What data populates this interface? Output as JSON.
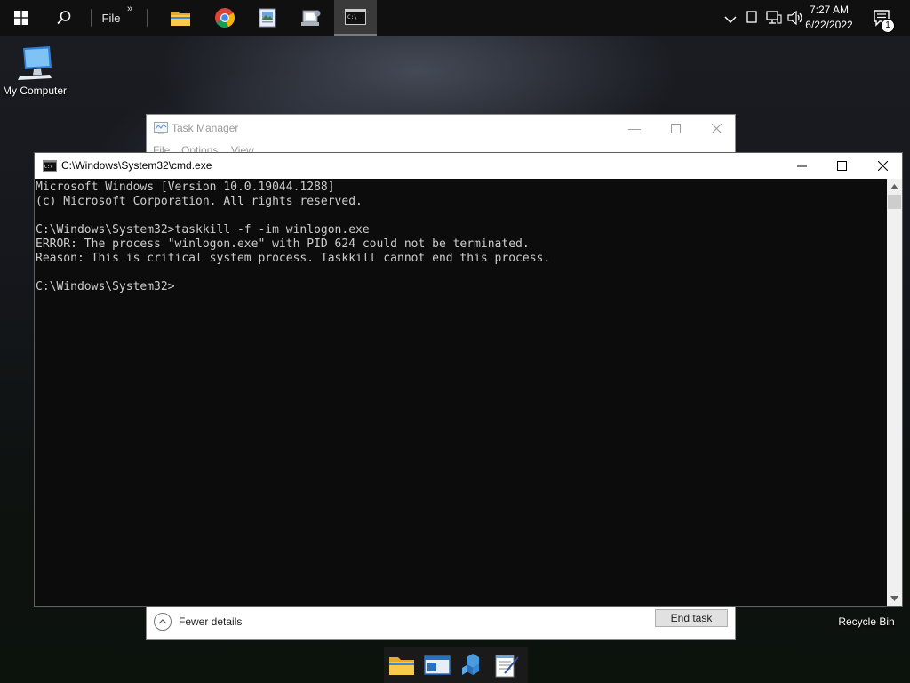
{
  "taskbar": {
    "file_label": "File",
    "overflow_glyph": "»",
    "apps": [
      {
        "name": "file-explorer-icon"
      },
      {
        "name": "chrome-icon"
      },
      {
        "name": "image-viewer-icon"
      },
      {
        "name": "system-app-icon"
      },
      {
        "name": "cmd-icon",
        "active": true
      }
    ],
    "clock": {
      "time": "7:27 AM",
      "date": "6/22/2022"
    },
    "notification_count": "1"
  },
  "desktop": {
    "my_computer_label": "My Computer",
    "recycle_bin_label": "Recycle Bin"
  },
  "task_manager": {
    "title": "Task Manager",
    "menu": [
      "File",
      "Options",
      "View"
    ],
    "fewer_details_label": "Fewer details",
    "end_task_label": "End task"
  },
  "cmd": {
    "title": "C:\\Windows\\System32\\cmd.exe",
    "lines": [
      "Microsoft Windows [Version 10.0.19044.1288]",
      "(c) Microsoft Corporation. All rights reserved.",
      "",
      "C:\\Windows\\System32>taskkill -f -im winlogon.exe",
      "ERROR: The process \"winlogon.exe\" with PID 624 could not be terminated.",
      "Reason: This is critical system process. Taskkill cannot end this process.",
      "",
      "C:\\Windows\\System32>"
    ]
  },
  "colors": {
    "console_bg": "#0c0c0c",
    "console_text": "#cccccc",
    "taskbar_bg": "#101010"
  }
}
